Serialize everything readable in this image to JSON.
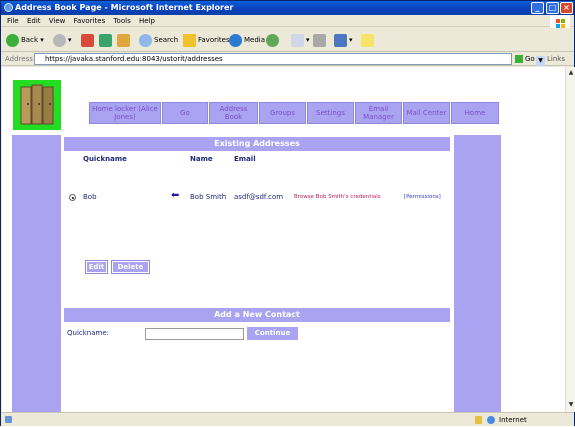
{
  "window": {
    "title": "Address Book Page - Microsoft Internet Explorer"
  },
  "menu": [
    "File",
    "Edit",
    "View",
    "Favorites",
    "Tools",
    "Help"
  ],
  "toolbar": {
    "back": "Back",
    "search": "Search",
    "favorites": "Favorites",
    "media": "Media"
  },
  "address_bar": {
    "label": "Address",
    "url": "https://javaka.stanford.edu:8043/ustorit/addresses",
    "go": "Go",
    "links": "Links"
  },
  "nav": [
    {
      "label": "Home locker (Alice Jones)"
    },
    {
      "label": "Go"
    },
    {
      "label": "Address Book"
    },
    {
      "label": "Groups"
    },
    {
      "label": "Settings"
    },
    {
      "label": "Email Manager"
    },
    {
      "label": "Mail Center"
    },
    {
      "label": "Home"
    }
  ],
  "existing": {
    "heading": "Existing Addresses",
    "columns": {
      "quickname": "Quickname",
      "name": "Name",
      "email": "Email"
    },
    "rows": [
      {
        "quickname": "Bob",
        "name": "Bob Smith",
        "email": "asdf@sdf.com",
        "browse": "Browse Bob Smith's credentials",
        "permissions": "[Permissions]"
      }
    ],
    "edit": "Edit",
    "delete": "Delete"
  },
  "add_contact": {
    "heading": "Add a New Contact",
    "quickname_label": "Quickname:",
    "quickname_value": "",
    "continue": "Continue"
  },
  "status": {
    "zone": "Internet"
  },
  "colors": {
    "accent": "#a9a3f2",
    "logo_green": "#22dd22",
    "text_navy": "#202a7a",
    "link_red": "#b0245a"
  }
}
